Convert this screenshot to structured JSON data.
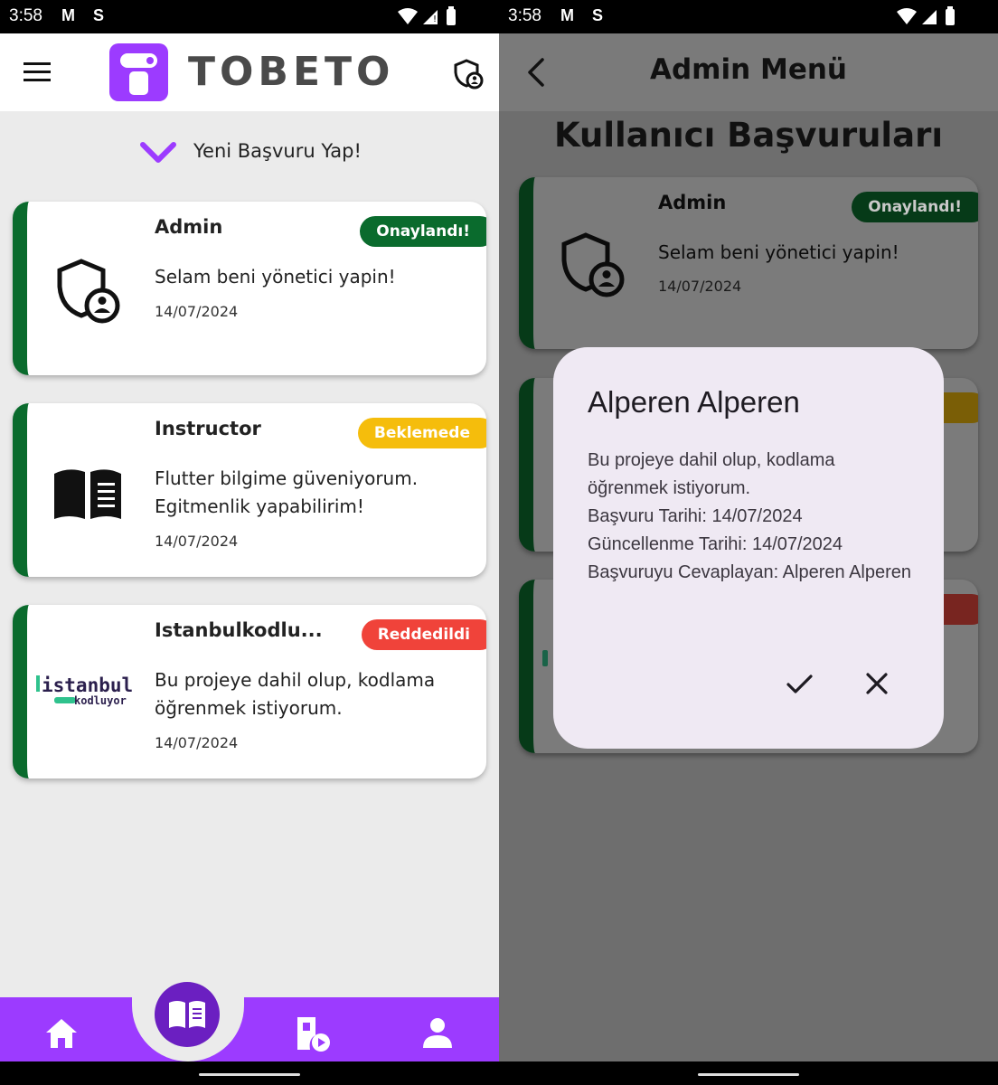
{
  "status_bar": {
    "time": "3:58",
    "gmail": "M",
    "extra": "S"
  },
  "left": {
    "app_title": "TOBETO",
    "apply_label": "Yeni Başvuru Yap!",
    "cards": [
      {
        "title": "Admin",
        "badge": "Onaylandı!",
        "badge_color": "#0a6b2d",
        "text": "Selam beni yönetici yapin!",
        "date": "14/07/2024",
        "icon": "shield-user-icon"
      },
      {
        "title": "Instructor",
        "badge": "Beklemede",
        "badge_color": "#f5bd0c",
        "text": "Flutter bilgime güveniyorum. Egitmenlik yapabilirim!",
        "date": "14/07/2024",
        "icon": "open-book-icon"
      },
      {
        "title": "Istanbulkodlu...",
        "badge": "Reddedildi",
        "badge_color": "#f0433a",
        "text": "Bu projeye dahil olup, kodlama öğrenmek istiyorum.",
        "date": "14/07/2024",
        "icon": "istanbul-kodluyor-logo",
        "logo_text_1": "istanbul",
        "logo_text_2": "kodluyor"
      }
    ],
    "bottom_nav": [
      "home-icon",
      "book-icon",
      "video-doc-icon",
      "person-icon"
    ]
  },
  "right": {
    "app_title": "Admin Menü",
    "heading": "Kullanıcı Başvuruları",
    "card": {
      "title": "Admin",
      "badge": "Onaylandı!",
      "text": "Selam beni yönetici yapin!",
      "date": "14/07/2024"
    },
    "dialog": {
      "title": "Alperen Alperen",
      "message": "Bu projeye dahil olup, kodlama öğrenmek istiyorum.",
      "applied": "Başvuru Tarihi: 14/07/2024",
      "updated": "Güncellenme Tarihi: 14/07/2024",
      "answered_by": "Başvuruyu Cevaplayan: Alperen Alperen"
    }
  },
  "colors": {
    "purple": "#9c3bff",
    "dark_purple": "#6b1fc1",
    "green": "#0a6b2d",
    "yellow": "#f5bd0c",
    "red": "#f0433a"
  }
}
